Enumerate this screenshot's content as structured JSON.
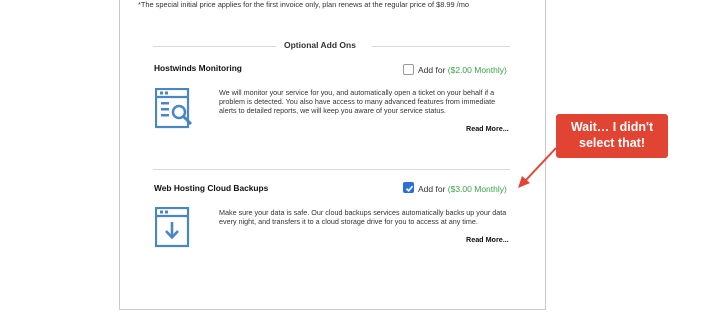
{
  "footnote": "*The special initial price applies for the first invoice only, plan renews at the regular price of $8.99 /mo",
  "section_title": "Optional Add Ons",
  "addons": [
    {
      "title": "Hostwinds Monitoring",
      "checked": false,
      "add_for": "Add for ",
      "price": "($2.00 Monthly)",
      "icon": "monitoring-search-icon",
      "description": "We will monitor your service for you, and automatically open a ticket on your behalf if a problem is detected. You also have access to many advanced features from immediate alerts to detailed reports, we will keep you aware of your service status.",
      "read_more": "Read More..."
    },
    {
      "title": "Web Hosting Cloud Backups",
      "checked": true,
      "add_for": "Add for ",
      "price": "($3.00 Monthly)",
      "icon": "backup-download-icon",
      "description": "Make sure your data is safe. Our cloud backups services automatically backs up your data every night, and transfers it to a cloud storage drive for you to access at any time.",
      "read_more": "Read More..."
    }
  ],
  "callout": {
    "line1": "Wait… I didn't",
    "line2": "select that!"
  },
  "colors": {
    "accent_blue": "#2a6fd6",
    "icon_blue": "#4a86c5",
    "price_green": "#3aa14a",
    "callout_red": "#e24434"
  }
}
